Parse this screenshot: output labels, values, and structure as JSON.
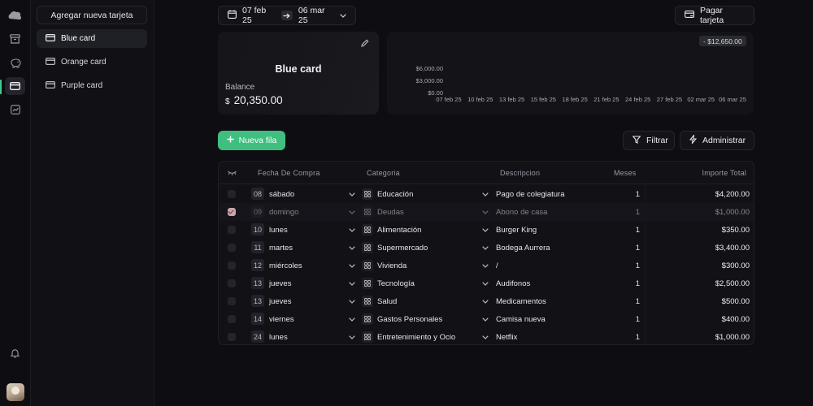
{
  "sidebar": {
    "add_card_label": "Agregar nueva tarjeta",
    "cards": [
      {
        "label": "Blue card",
        "active": true
      },
      {
        "label": "Orange card",
        "active": false
      },
      {
        "label": "Purple card",
        "active": false
      }
    ]
  },
  "rail": {
    "icons": [
      "cloud-logo-icon",
      "archive-icon",
      "piggy-bank-icon",
      "credit-card-icon",
      "chart-icon",
      "bell-icon"
    ],
    "active_icon": "credit-card-icon"
  },
  "toolbar": {
    "date_start": "07 feb 25",
    "date_end": "06 mar 25",
    "pay_label": "Pagar tarjeta"
  },
  "card": {
    "title": "Blue card",
    "balance_label": "Balance",
    "currency": "$",
    "balance": "20,350.00"
  },
  "chart_data": {
    "type": "bar",
    "badge": "- $12,650.00",
    "y_ticks": [
      "$6,000.00",
      "$3,000.00",
      "$0.00"
    ],
    "categories": [
      "07 feb 25",
      "10 feb 25",
      "13 feb 25",
      "15 feb 25",
      "18 feb 25",
      "21 feb 25",
      "24 feb 25",
      "27 feb 25",
      "02 mar 25",
      "06 mar 25"
    ],
    "ylim": [
      0,
      6000
    ]
  },
  "actions": {
    "new_row": "Nueva fila",
    "filter": "Filtrar",
    "manage": "Administrar"
  },
  "table": {
    "headers": {
      "date": "Fecha De Compra",
      "category": "Categoria",
      "description": "Descripcion",
      "months": "Meses",
      "amount": "Importe Total"
    },
    "rows": [
      {
        "day": "08",
        "weekday": "sábado",
        "category": "Educación",
        "description": "Pago de colegiatura",
        "months": "1",
        "amount": "$4,200.00",
        "checked": false
      },
      {
        "day": "09",
        "weekday": "domingo",
        "category": "Deudas",
        "description": "Abono de casa",
        "months": "1",
        "amount": "$1,000.00",
        "checked": true
      },
      {
        "day": "10",
        "weekday": "lunes",
        "category": "Alimentación",
        "description": "Burger King",
        "months": "1",
        "amount": "$350.00",
        "checked": false
      },
      {
        "day": "11",
        "weekday": "martes",
        "category": "Supermercado",
        "description": "Bodega Aurrera",
        "months": "1",
        "amount": "$3,400.00",
        "checked": false
      },
      {
        "day": "12",
        "weekday": "miércoles",
        "category": "Vivienda",
        "description": "/",
        "months": "1",
        "amount": "$300.00",
        "checked": false
      },
      {
        "day": "13",
        "weekday": "jueves",
        "category": "Tecnología",
        "description": "Audifonos",
        "months": "1",
        "amount": "$2,500.00",
        "checked": false
      },
      {
        "day": "13",
        "weekday": "jueves",
        "category": "Salud",
        "description": "Medicamentos",
        "months": "1",
        "amount": "$500.00",
        "checked": false
      },
      {
        "day": "14",
        "weekday": "viernes",
        "category": "Gastos Personales",
        "description": "Camisa nueva",
        "months": "1",
        "amount": "$400.00",
        "checked": false
      },
      {
        "day": "24",
        "weekday": "lunes",
        "category": "Entretenimiento y Ocio",
        "description": "Netflix",
        "months": "1",
        "amount": "$1,000.00",
        "checked": false
      }
    ]
  },
  "colors": {
    "accent": "#3fbf7f",
    "background": "#0e0e12",
    "panel": "#131318"
  }
}
